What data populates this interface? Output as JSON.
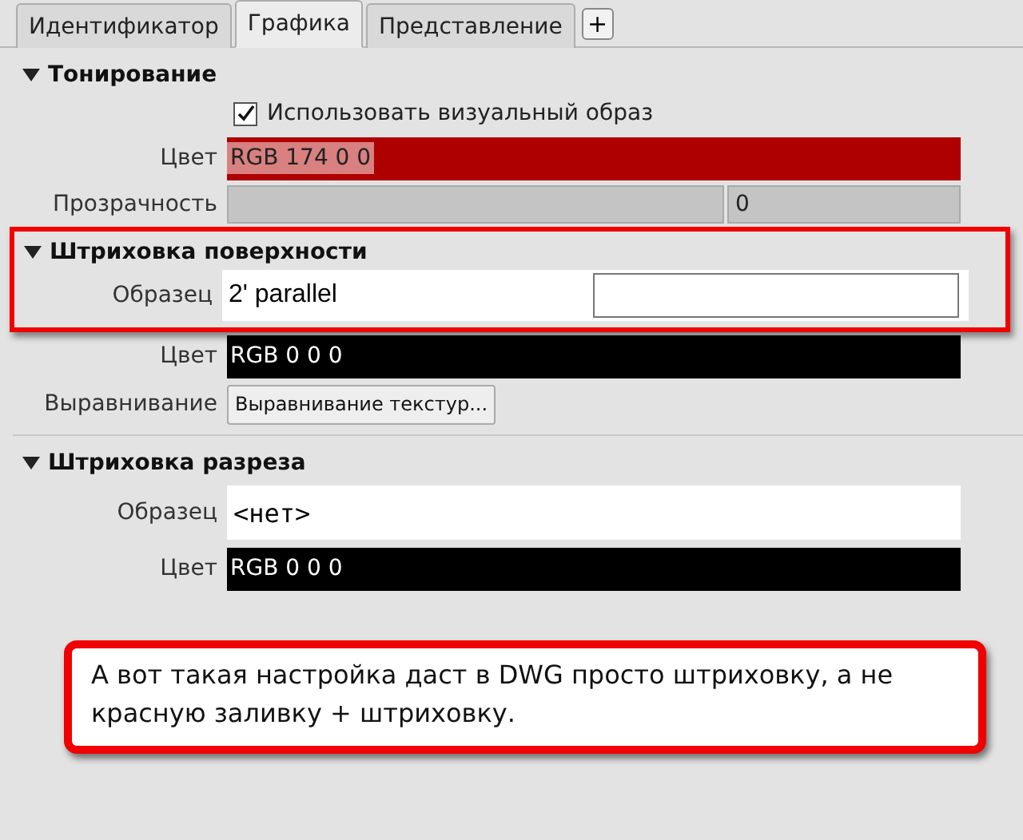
{
  "tabs": [
    {
      "label": "Идентификатор",
      "selected": false
    },
    {
      "label": "Графика",
      "selected": true
    },
    {
      "label": "Представление",
      "selected": false
    }
  ],
  "add_tab_button": "+",
  "sections": [
    {
      "title": "Тонирование",
      "expanded": true,
      "highlighted": false,
      "rows": [
        {
          "kind": "checkbox",
          "label": "Использовать визуальный образ",
          "checked": true
        },
        {
          "kind": "color",
          "label": "Цвет",
          "value": "RGB 174 0 0",
          "color": "#ae0000",
          "text_selected": true
        },
        {
          "kind": "slider",
          "label": "Прозрачность",
          "value": "0",
          "disabled": true
        }
      ]
    },
    {
      "title": "Штриховка поверхности",
      "expanded": true,
      "highlighted": true,
      "rows": [
        {
          "kind": "pattern",
          "label": "Образец",
          "value": "2' parallel",
          "preview": true
        }
      ]
    },
    {
      "highlighted": false,
      "rows": [
        {
          "kind": "color",
          "label": "Цвет",
          "value": "RGB 0 0 0",
          "color": "#000000",
          "text_selected": false
        },
        {
          "kind": "button",
          "label": "Выравнивание",
          "value": "Выравнивание текстур..."
        }
      ]
    },
    {
      "title": "Штриховка разреза",
      "expanded": true,
      "highlighted": false,
      "rows": [
        {
          "kind": "pattern",
          "label": "Образец",
          "value": "<нет>",
          "preview": false
        },
        {
          "kind": "color",
          "label": "Цвет",
          "value": "RGB 0 0 0",
          "color": "#000000",
          "text_selected": false
        }
      ]
    }
  ],
  "callout": "А вот такая настройка даст в DWG просто штриховку, а не красную заливку + штриховку."
}
